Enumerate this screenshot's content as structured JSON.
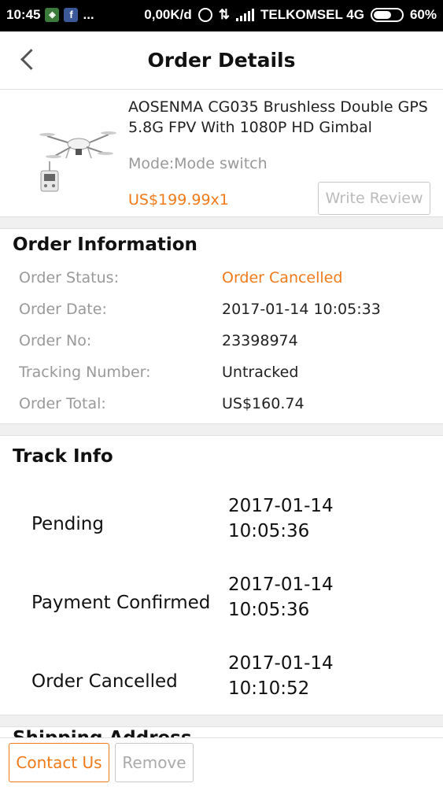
{
  "status_bar": {
    "time": "10:45",
    "dots": "...",
    "speed": "0,00K/d",
    "carrier": "TELKOMSEL 4G",
    "battery": "60%"
  },
  "header": {
    "title": "Order Details"
  },
  "product": {
    "name": "AOSENMA CG035 Brushless Double GPS 5.8G FPV With 1080P HD Gimbal",
    "mode": "Mode:Mode switch",
    "price": "US$199.99x1",
    "write_review_label": "Write Review"
  },
  "order_information": {
    "title": "Order Information",
    "rows": [
      {
        "label": "Order Status:",
        "value": "Order Cancelled"
      },
      {
        "label": "Order Date:",
        "value": "2017-01-14 10:05:33"
      },
      {
        "label": "Order No:",
        "value": "23398974"
      },
      {
        "label": "Tracking Number:",
        "value": "Untracked"
      },
      {
        "label": "Order Total:",
        "value": "US$160.74"
      }
    ],
    "status_color": "#f07a1a"
  },
  "track_info": {
    "title": "Track Info",
    "events": [
      {
        "status": "Pending",
        "date": "2017-01-14",
        "time": "10:05:36"
      },
      {
        "status": "Payment Confirmed",
        "date": "2017-01-14",
        "time": "10:05:36"
      },
      {
        "status": "Order Cancelled",
        "date": "2017-01-14",
        "time": "10:10:52"
      }
    ]
  },
  "shipping_address": {
    "title": "Shipping Address"
  },
  "bottom_bar": {
    "contact_label": "Contact Us",
    "remove_label": "Remove"
  },
  "colors": {
    "accent": "#f07a1a"
  }
}
